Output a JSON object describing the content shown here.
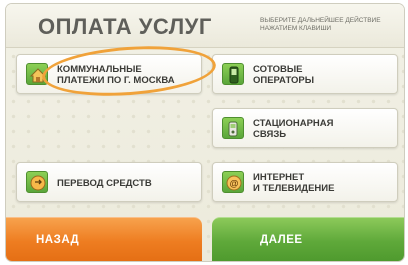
{
  "header": {
    "title": "ОПЛАТА УСЛУГ",
    "hint": "ВЫБЕРИТЕ ДАЛЬНЕЙШЕЕ ДЕЙСТВИЕ НАЖАТИЕМ КЛАВИШИ"
  },
  "menu": {
    "items": [
      {
        "label": "КОММУНАЛЬНЫЕ\nПЛАТЕЖИ ПО г. МОСКВА",
        "icon": "house-icon"
      },
      {
        "label": "СОТОВЫЕ\nОПЕРАТОРЫ",
        "icon": "mobile-phone-icon"
      },
      {
        "label": "СТАЦИОНАРНАЯ\nСВЯЗЬ",
        "icon": "landline-phone-icon"
      },
      {
        "label": "ПЕРЕВОД СРЕДСТВ",
        "icon": "transfer-icon"
      },
      {
        "label": "ИНТЕРНЕТ\nИ ТЕЛЕВИДЕНИЕ",
        "icon": "internet-icon"
      }
    ]
  },
  "nav": {
    "back_label": "НАЗАД",
    "next_label": "ДАЛЕЕ"
  },
  "colors": {
    "accent_green": "#5fa93a",
    "accent_orange": "#ee7d21",
    "highlight_circle": "#f0a23a"
  }
}
